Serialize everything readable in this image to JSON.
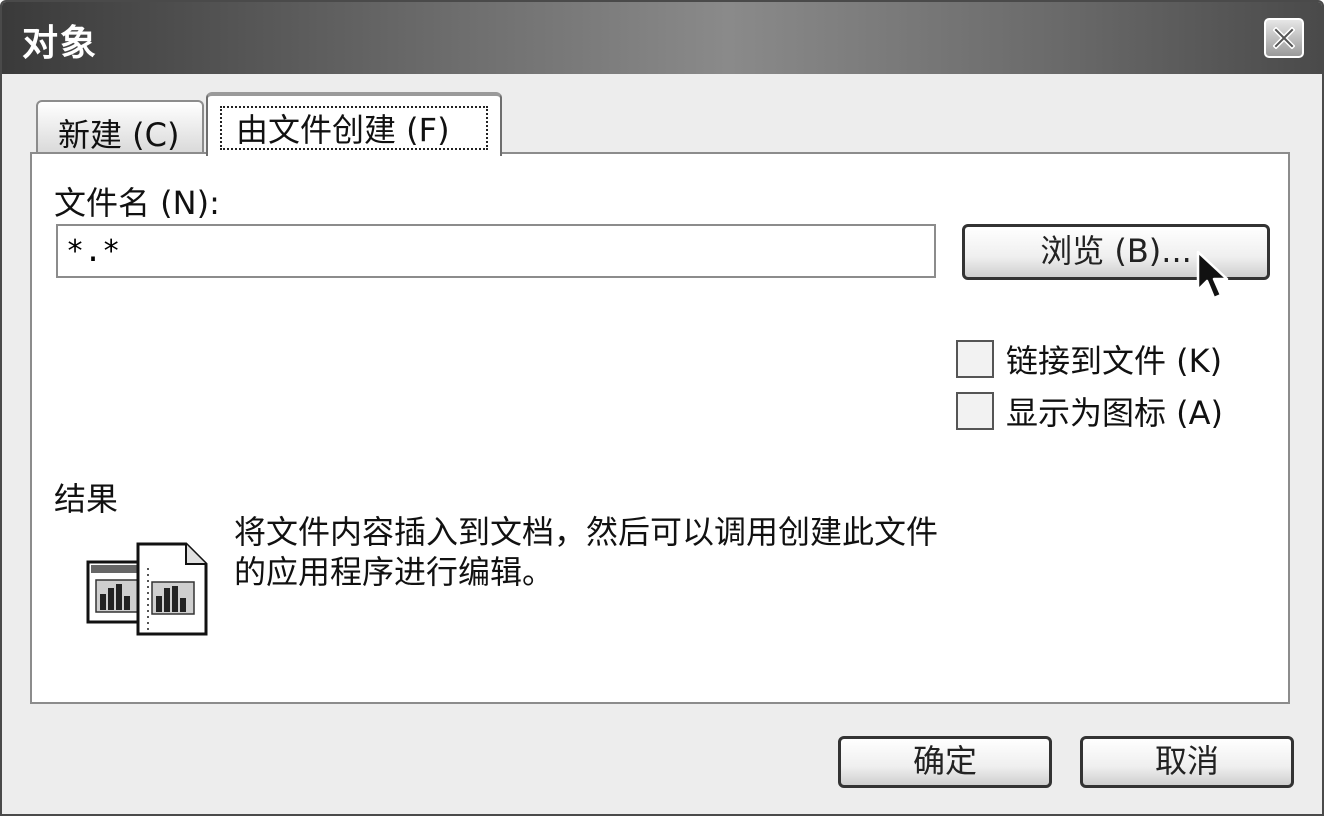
{
  "dialog": {
    "title": "对象",
    "close_icon": "close-icon"
  },
  "tabs": [
    {
      "label": "新建 (C)",
      "selected": false
    },
    {
      "label": "由文件创建 (F)",
      "selected": true
    }
  ],
  "file": {
    "label": "文件名 (N):",
    "value": "*.*",
    "browse_label": "浏览 (B)..."
  },
  "options": {
    "link_label": "链接到文件 (K)",
    "link_checked": false,
    "icon_label": "显示为图标 (A)",
    "icon_checked": false
  },
  "result": {
    "label": "结果",
    "text": "将文件内容插入到文档，然后可以调用创建此文件的应用程序进行编辑。",
    "icon": "embedded-document-icon"
  },
  "buttons": {
    "ok": "确定",
    "cancel": "取消"
  },
  "cursor_icon": "mouse-pointer-icon"
}
